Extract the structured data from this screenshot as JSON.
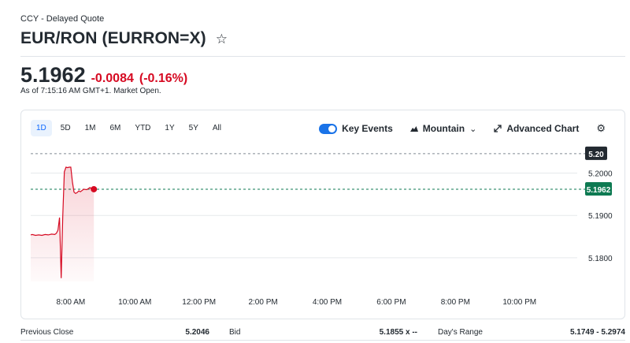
{
  "header": {
    "quote_source": "CCY - Delayed Quote",
    "title": "EUR/RON (EURRON=X)",
    "watchlist_icon": "star-outline-icon"
  },
  "quote": {
    "price": "5.1962",
    "change": "-0.0084",
    "change_percent": "(-0.16%)",
    "as_of": "As of 7:15:16 AM GMT+1. Market Open.",
    "change_color": "#d60a22"
  },
  "chart_toolbar": {
    "ranges": [
      "1D",
      "5D",
      "1M",
      "6M",
      "YTD",
      "1Y",
      "5Y",
      "All"
    ],
    "active_range": "1D",
    "key_events_label": "Key Events",
    "key_events_on": true,
    "chart_type_label": "Mountain",
    "chart_type_icon": "mountain-icon",
    "advanced_chart_label": "Advanced Chart",
    "advanced_chart_icon": "expand-arrows-icon",
    "settings_icon": "gear-icon"
  },
  "chart_data": {
    "type": "area",
    "x_tick_labels": [
      "8:00 AM",
      "10:00 AM",
      "12:00 PM",
      "2:00 PM",
      "4:00 PM",
      "6:00 PM",
      "8:00 PM",
      "10:00 PM"
    ],
    "x_ticks_hours": [
      8,
      10,
      12,
      14,
      16,
      18,
      20,
      22
    ],
    "x_range_hours": [
      6.75,
      23.8
    ],
    "y_tick_labels": [
      "5.2000",
      "5.1900",
      "5.1800"
    ],
    "y_ticks": [
      5.2,
      5.19,
      5.18
    ],
    "ylim": [
      5.1744,
      5.2042
    ],
    "previous_close": 5.2046,
    "previous_close_label": "5.20",
    "current_value": 5.1962,
    "current_label": "5.1962",
    "series": [
      {
        "x": [
          6.75,
          6.8,
          6.9,
          7.0,
          7.1,
          7.2,
          7.3,
          7.4,
          7.5,
          7.55,
          7.6,
          7.65,
          7.7,
          7.75,
          7.8,
          7.85,
          7.9,
          7.95,
          8.0,
          8.05,
          8.1,
          8.15,
          8.2,
          8.25,
          8.3,
          8.4,
          8.5,
          8.6,
          8.65,
          8.72
        ],
        "values": [
          5.1854,
          5.1855,
          5.1853,
          5.1854,
          5.1853,
          5.1855,
          5.1854,
          5.1856,
          5.1855,
          5.1858,
          5.1865,
          5.1895,
          5.1752,
          5.1898,
          5.2003,
          5.2014,
          5.2013,
          5.2014,
          5.2014,
          5.198,
          5.1955,
          5.1952,
          5.1954,
          5.1958,
          5.1956,
          5.1962,
          5.1961,
          5.1966,
          5.1962,
          5.1962
        ]
      }
    ],
    "line_color": "#d60a22",
    "ref_line_color": "#818b94",
    "current_badge_color": "#0e7a52",
    "prev_close_badge_color": "#232a31",
    "grid": true
  },
  "stats": {
    "previous_close_label": "Previous Close",
    "previous_close_value": "5.2046",
    "bid_label": "Bid",
    "bid_value": "5.1855 x --",
    "days_range_label": "Day's Range",
    "days_range_value": "5.1749 - 5.2974"
  }
}
